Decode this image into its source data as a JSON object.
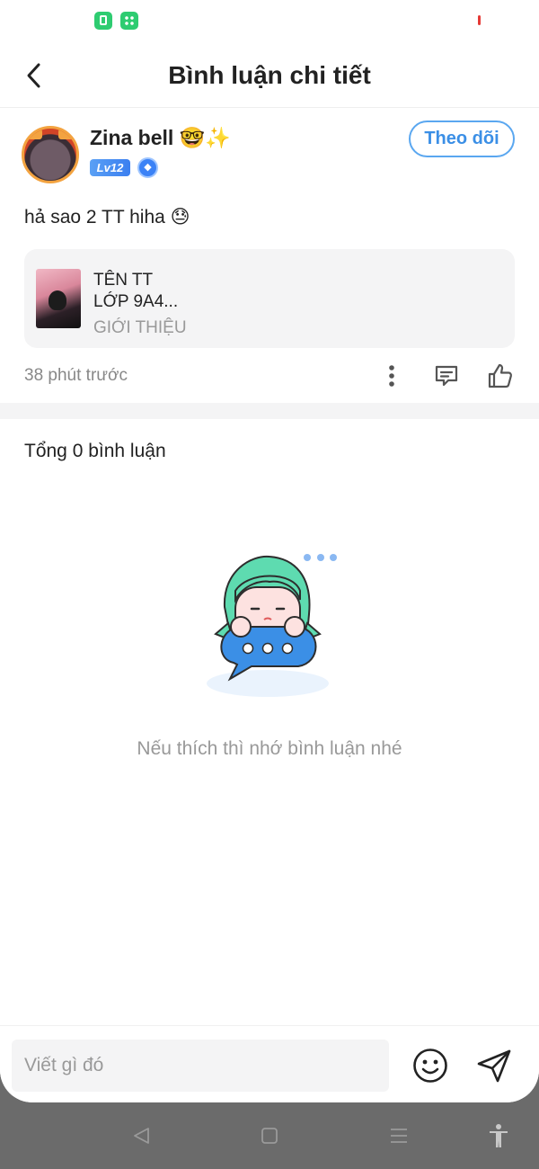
{
  "header": {
    "title": "Bình luận chi tiết"
  },
  "post": {
    "username": "Zina bell 🤓✨",
    "level": "Lv12",
    "follow_label": "Theo dõi",
    "text": "hả sao 2 TT hiha 😓",
    "shared": {
      "line1": "TÊN TT",
      "line2": "LỚP 9A4...",
      "line3": "GIỚI THIỆU"
    },
    "time": "38 phút trước"
  },
  "comments": {
    "total_label": "Tổng 0 bình luận",
    "empty_text": "Nếu thích thì nhớ bình luận nhé"
  },
  "input": {
    "placeholder": "Viết gì đó"
  },
  "colors": {
    "accent": "#3b8fe6",
    "green": "#2ecc71",
    "muted": "#999999"
  }
}
